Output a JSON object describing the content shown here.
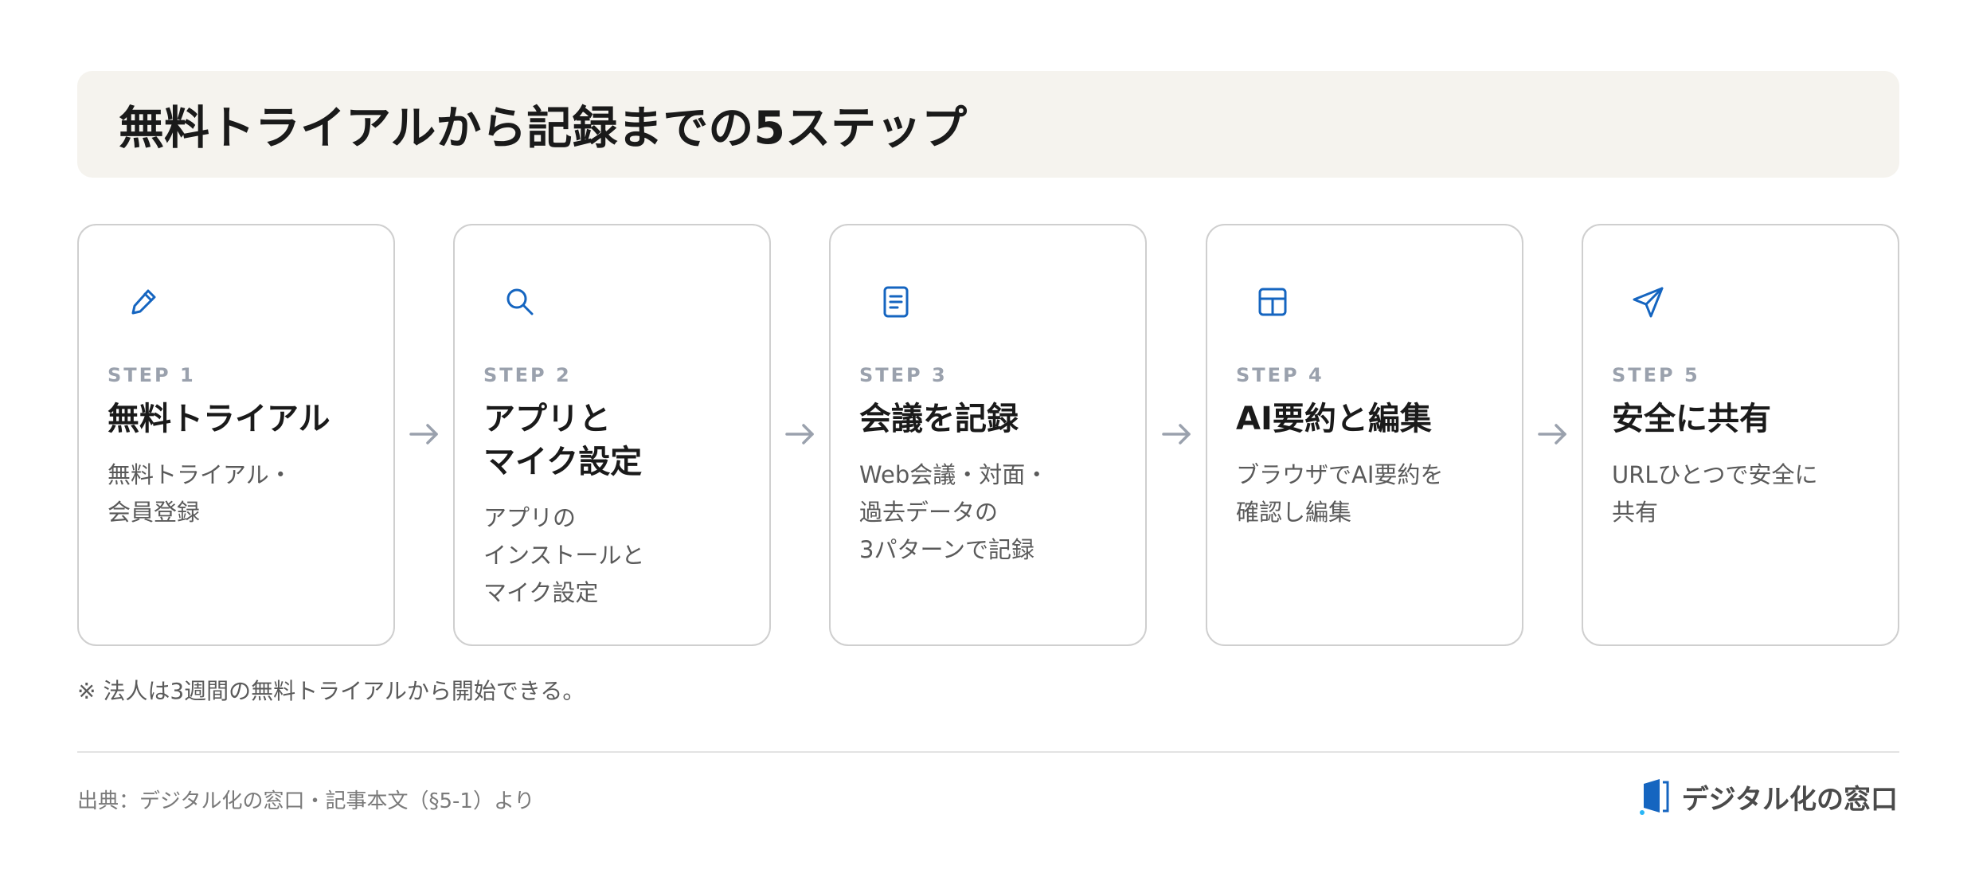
{
  "header": {
    "title": "無料トライアルから記録までの5ステップ"
  },
  "steps": [
    {
      "icon": "pencil-icon",
      "label": "STEP 1",
      "title": "無料トライアル",
      "description": "無料トライアル・\n会員登録"
    },
    {
      "icon": "search-icon",
      "label": "STEP 2",
      "title": "アプリと\nマイク設定",
      "description": "アプリの\nインストールと\nマイク設定"
    },
    {
      "icon": "document-icon",
      "label": "STEP 3",
      "title": "会議を記録",
      "description": "Web会議・対面・\n過去データの\n3パターンで記録"
    },
    {
      "icon": "layout-icon",
      "label": "STEP 4",
      "title": "AI要約と編集",
      "description": "ブラウザでAI要約を\n確認し編集"
    },
    {
      "icon": "send-icon",
      "label": "STEP 5",
      "title": "安全に共有",
      "description": "URLひとつで安全に\n共有"
    }
  ],
  "note": "※ 法人は3週間の無料トライアルから開始できる。",
  "footer": {
    "source": "出典：デジタル化の窓口・記事本文（§5-1）より",
    "brand": "デジタル化の窓口"
  },
  "colors": {
    "accent": "#1565c0",
    "header_bg": "#f5f3ee",
    "card_border": "#cfcfcf",
    "step_label": "#9aa1ad",
    "arrow": "#9aa1ad"
  }
}
